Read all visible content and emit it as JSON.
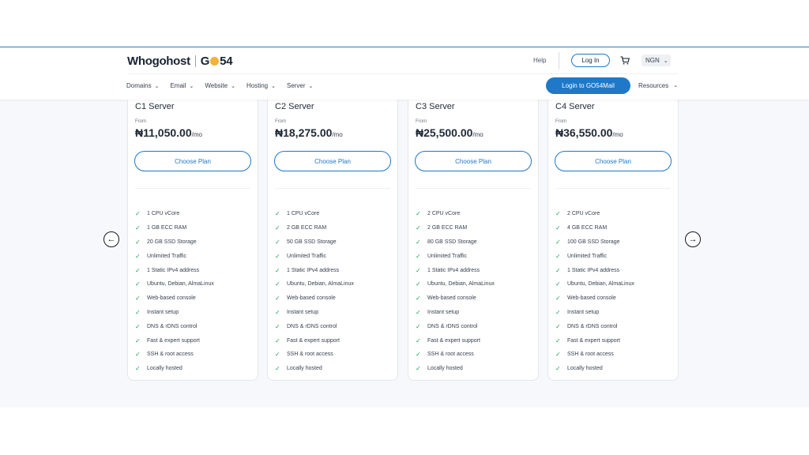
{
  "header": {
    "logo_text": "hogohost",
    "logo_w": "W",
    "logo_go": "G",
    "logo_54": "54",
    "help": "Help",
    "login": "Log In",
    "currency": "NGN",
    "nav": [
      "Domains",
      "Email",
      "Website",
      "Hosting",
      "Server"
    ],
    "gos_button": "Login to GO54Mail",
    "resources": "Resources"
  },
  "plans": [
    {
      "name": "C1 Server",
      "from": "From",
      "price": "₦11,050.00",
      "per": "/mo",
      "cta": "Choose Plan",
      "features": [
        "1 CPU vCore",
        "1 GB ECC RAM",
        "20 GB SSD Storage",
        "Unlimited Traffic",
        "1 Static IPv4 address",
        "Ubuntu, Debian, AlmaLinux",
        "Web-based console",
        "Instant setup",
        "DNS & rDNS control",
        "Fast & expert support",
        "SSH & root access",
        "Locally hosted"
      ]
    },
    {
      "name": "C2 Server",
      "from": "From",
      "price": "₦18,275.00",
      "per": "/mo",
      "cta": "Choose Plan",
      "features": [
        "1 CPU vCore",
        "2 GB ECC RAM",
        "50 GB SSD Storage",
        "Unlimited Traffic",
        "1 Static IPv4 address",
        "Ubuntu, Debian, AlmaLinux",
        "Web-based console",
        "Instant setup",
        "DNS & rDNS control",
        "Fast & expert support",
        "SSH & root access",
        "Locally hosted"
      ]
    },
    {
      "name": "C3 Server",
      "from": "From",
      "price": "₦25,500.00",
      "per": "/mo",
      "cta": "Choose Plan",
      "features": [
        "2 CPU vCore",
        "2 GB ECC RAM",
        "80 GB SSD Storage",
        "Unlimited Traffic",
        "1 Static IPv4 address",
        "Ubuntu, Debian, AlmaLinux",
        "Web-based console",
        "Instant setup",
        "DNS & rDNS control",
        "Fast & expert support",
        "SSH & root access",
        "Locally hosted"
      ]
    },
    {
      "name": "C4 Server",
      "from": "From",
      "price": "₦36,550.00",
      "per": "/mo",
      "cta": "Choose Plan",
      "features": [
        "2 CPU vCore",
        "4 GB ECC RAM",
        "100 GB SSD Storage",
        "Unlimited Traffic",
        "1 Static IPv4 address",
        "Ubuntu, Debian, AlmaLinux",
        "Web-based console",
        "Instant setup",
        "DNS & rDNS control",
        "Fast & expert support",
        "SSH & root access",
        "Locally hosted"
      ]
    }
  ],
  "colors": {
    "accent": "#1f78c8",
    "check": "#22a05a"
  }
}
